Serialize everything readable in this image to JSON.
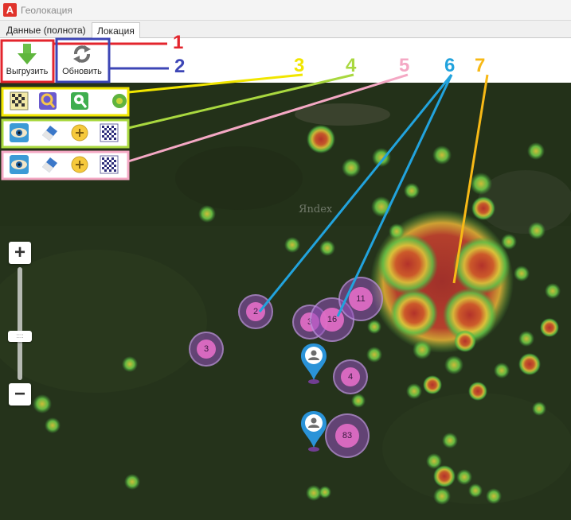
{
  "window": {
    "title": "Геолокация"
  },
  "tabs": [
    {
      "label": "Данные (полнота)",
      "active": false
    },
    {
      "label": "Локация",
      "active": true
    }
  ],
  "toolbar": {
    "export_label": "Выгрузить",
    "refresh_label": "Обновить"
  },
  "tool_rows": {
    "row3": [
      "checker-layer-icon",
      "search-area-icon",
      "location-pin-icon",
      "green-dot-icon"
    ],
    "row4": [
      "eye-icon",
      "eraser-icon",
      "add-circle-icon",
      "grid-pattern-icon"
    ],
    "row5": [
      "eye-icon",
      "eraser-icon",
      "add-circle-icon",
      "grid-pattern-icon"
    ]
  },
  "map": {
    "watermark": "Яndex",
    "zoom_in": "+",
    "zoom_out": "−",
    "zoom_handle": "::::",
    "clusters": [
      {
        "count": "2"
      },
      {
        "count": "3"
      },
      {
        "count": "3"
      },
      {
        "count": "16"
      },
      {
        "count": "11"
      },
      {
        "count": "4"
      },
      {
        "count": "83"
      }
    ]
  },
  "annotations": {
    "n1": "1",
    "n2": "2",
    "n3": "3",
    "n4": "4",
    "n5": "5",
    "n6": "6",
    "n7": "7"
  },
  "colors": {
    "callout_1": "#e3252d",
    "callout_2": "#3d46b6",
    "callout_3": "#f1e600",
    "callout_4": "#a9d83f",
    "callout_5": "#f4a8c4",
    "callout_6": "#22a3dd",
    "callout_7": "#f7b916",
    "heat_core": "#a8322a",
    "map_base": "#25331b"
  }
}
